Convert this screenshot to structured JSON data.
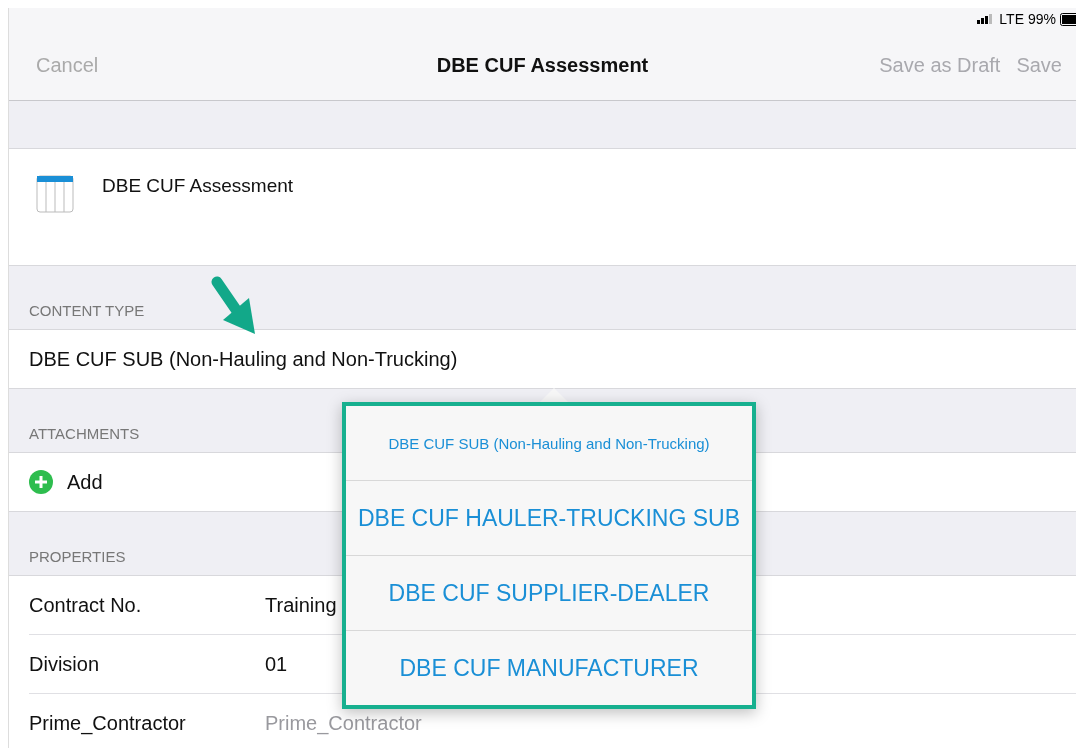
{
  "status_bar": {
    "network": "LTE",
    "battery": "99%"
  },
  "nav_bar": {
    "cancel": "Cancel",
    "title": "DBE CUF Assessment",
    "actions": [
      {
        "label": "Save as Draft",
        "disabled": true
      },
      {
        "label": "Save",
        "disabled": true
      }
    ]
  },
  "header": {
    "title": "DBE CUF Assessment"
  },
  "sections": [
    {
      "kind": "content_type",
      "heading": "CONTENT TYPE",
      "value": "DBE CUF SUB (Non-Hauling and Non-Trucking)"
    },
    {
      "kind": "attachments",
      "heading": "ATTACHMENTS",
      "add": "Add"
    },
    {
      "kind": "properties",
      "heading": "PROPERTIES",
      "rows": [
        {
          "label": "Contract No.",
          "value": "Training"
        },
        {
          "label": "Division",
          "value": "01"
        },
        {
          "label": "Prime_Contractor",
          "placeholder": "Prime_Contractor"
        }
      ]
    }
  ],
  "popover": {
    "options": [
      {
        "label": "DBE CUF SUB (Non-Hauling and Non-Trucking)",
        "selected": true
      },
      {
        "label": "DBE CUF HAULER-TRUCKING SUB",
        "selected": false
      },
      {
        "label": "DBE CUF SUPPLIER-DEALER",
        "selected": false
      },
      {
        "label": "DBE CUF MANUFACTURER",
        "selected": false
      }
    ]
  }
}
